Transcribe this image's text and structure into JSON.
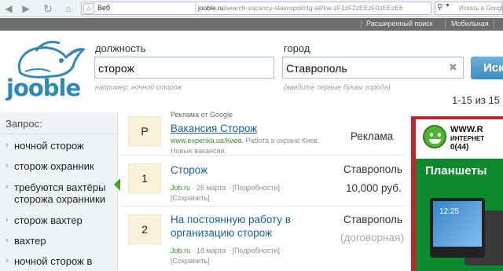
{
  "browser": {
    "addr_label": "Веб",
    "url_domain": "jooble.ru",
    "url_path": "/search-vacancy-stavropol/ctg-all/kw-zF1zF2zEEzF0zEEzE6",
    "search_placeholder": "Искать в Google"
  },
  "header": {
    "advanced_search": "Расширенный поиск",
    "mobile": "Мобильная"
  },
  "logo": {
    "text": "jooble"
  },
  "search": {
    "position_label": "должность",
    "position_value": "сторож",
    "position_hint": "например: ночной сторож",
    "city_label": "город",
    "city_value": "Ставрополь",
    "city_hint": "(введите первые буквы города)",
    "find_button": "Иск"
  },
  "results_count": "1-15 из 15",
  "sidebar": {
    "title": "Запрос:",
    "items": [
      "ночной сторож",
      "сторож охранник",
      "требуются вахтёры сторожа охранники",
      "сторож вахтер",
      "вахтер",
      "ночной сторож в"
    ]
  },
  "results": [
    {
      "badge": "P",
      "label": "Реклама от Google",
      "title": "Вакансия Сторож",
      "source": "www.experika.ua/Киев.",
      "snippet": "Работа в охране Киев.",
      "snippet2": "Новые вакансии.",
      "right": "Реклама"
    },
    {
      "badge": "1",
      "title": "Сторож",
      "source": "Job.ru",
      "date": "26 марта",
      "details": "[Подробности]",
      "save": "[Сохранить]",
      "city": "Ставрополь",
      "salary": "10,000 руб."
    },
    {
      "badge": "2",
      "title_line1": "На постоянную работу в",
      "title_line2": "организацию сторож",
      "source": "Job.ru",
      "date": "18 марта",
      "details": "[Подробности]",
      "save": "[Сохранить]",
      "city": "Ставрополь",
      "salary": "(договорная)"
    }
  ],
  "banner": {
    "www": "WWW.R",
    "inet": "ИНТЕРНЕТ",
    "phone": "0(44)",
    "headline": "Планшеты",
    "clock": "12:25"
  },
  "colors": {
    "accent": "#2f89b8",
    "link": "#1a5fa6",
    "source_green": "#3f8f2a",
    "banner_red": "#cc1f2c",
    "banner_green": "#0d8a2e"
  }
}
